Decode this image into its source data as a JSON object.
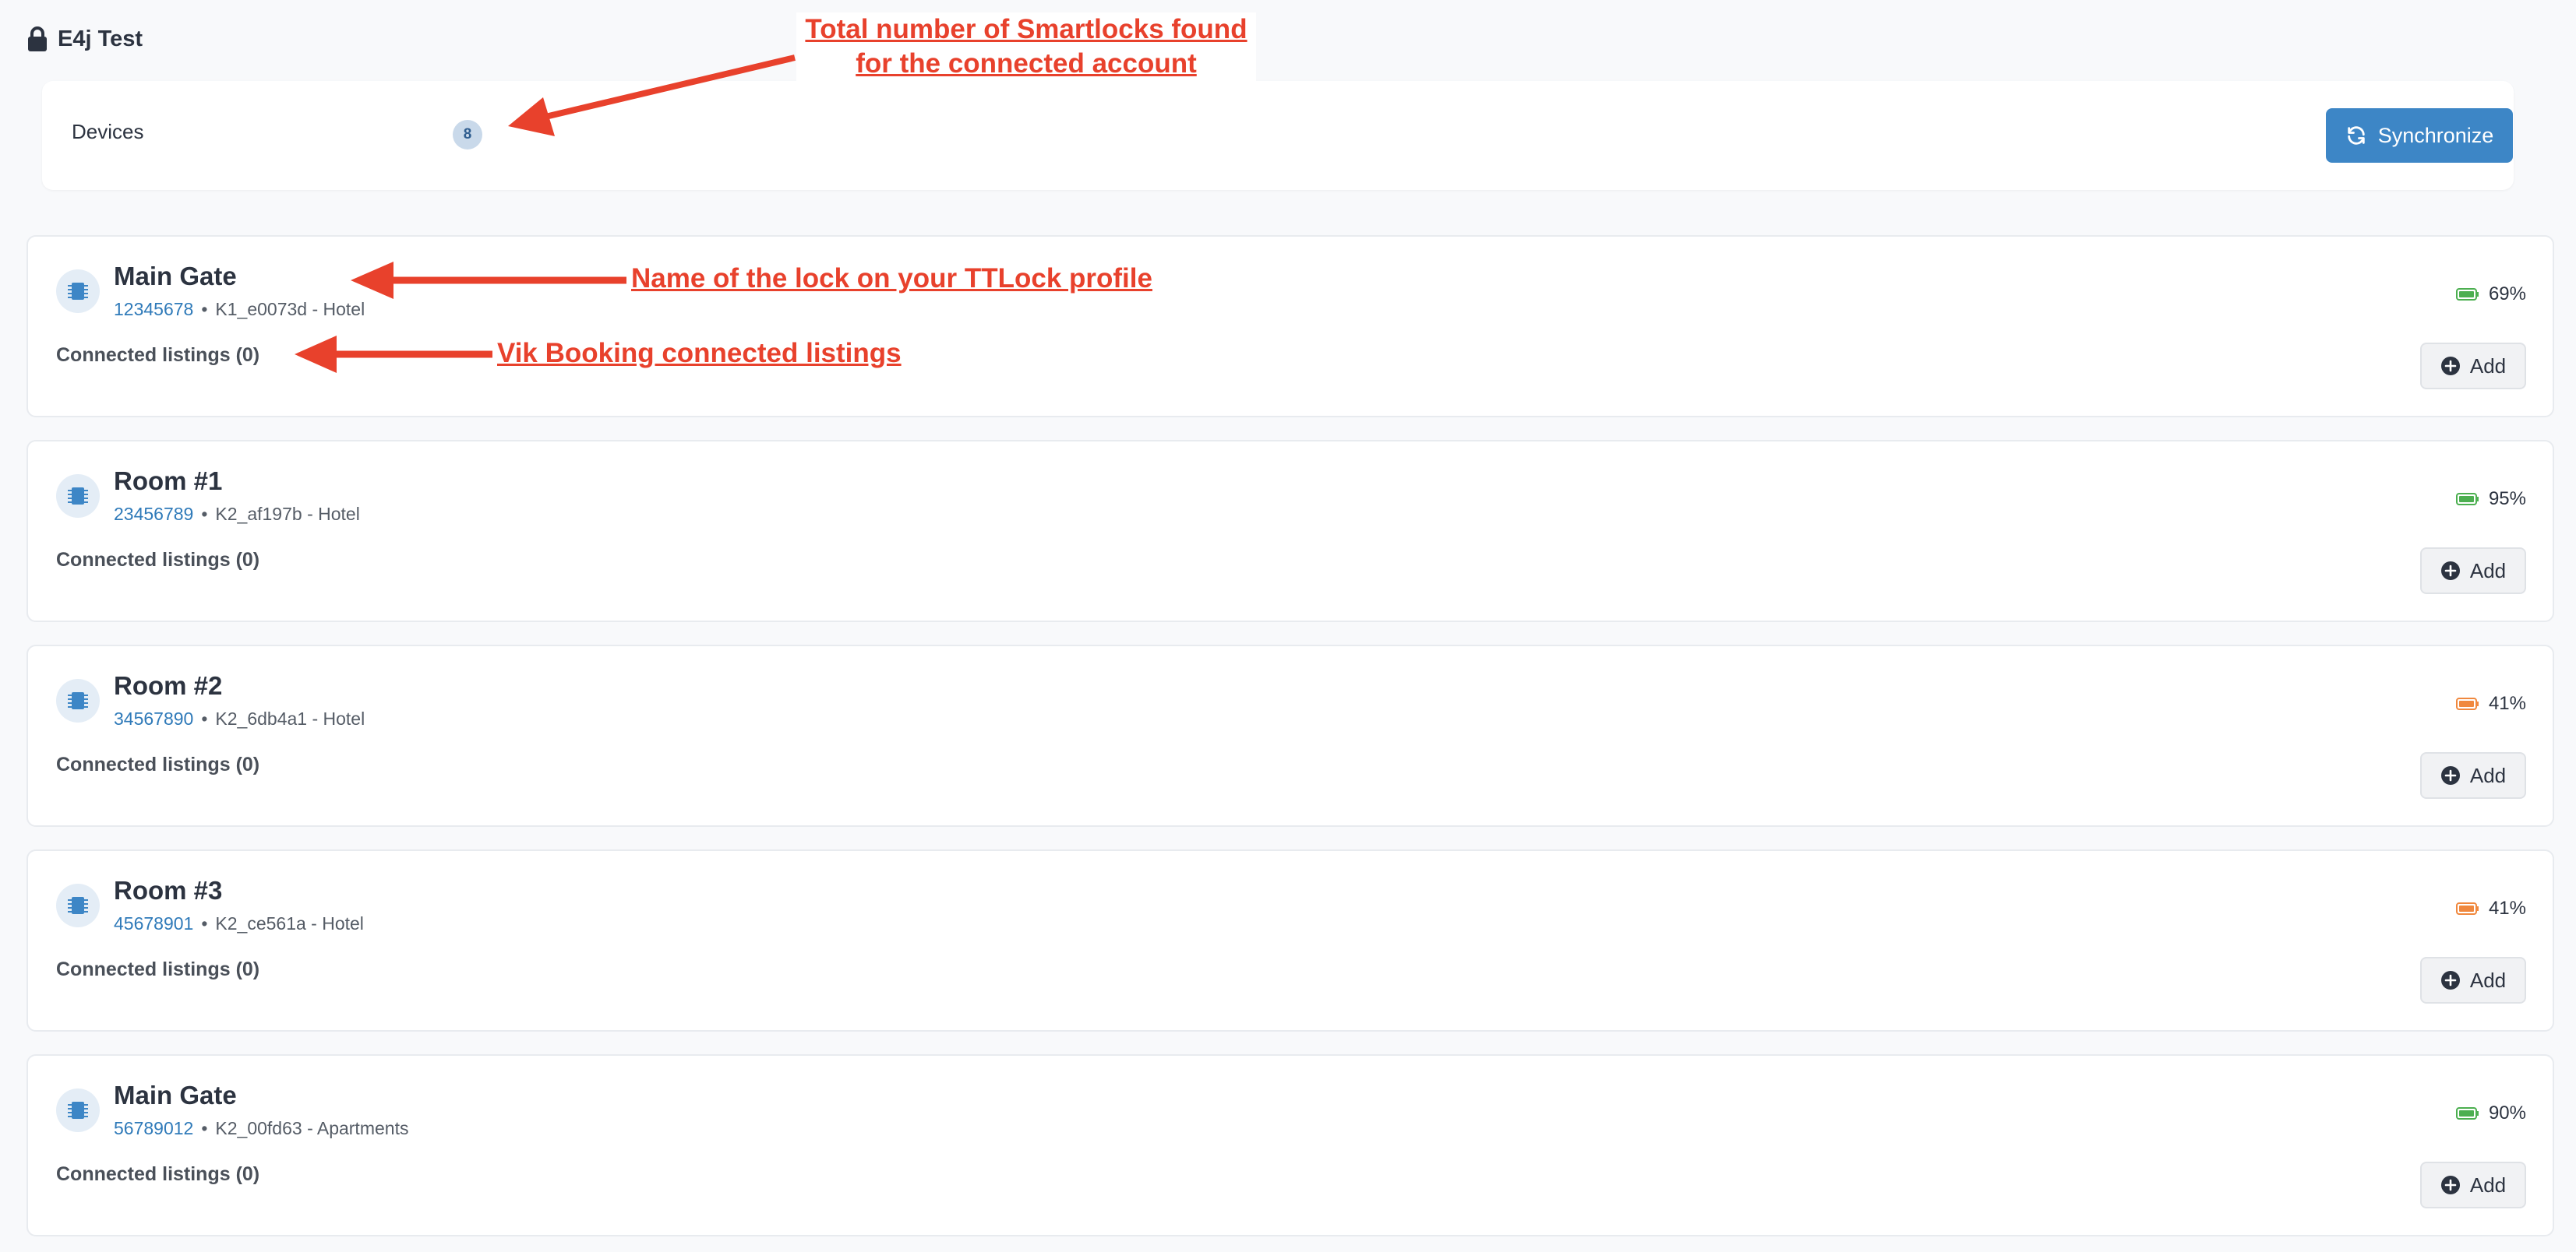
{
  "app": {
    "title": "E4j Test"
  },
  "devices": {
    "label": "Devices",
    "count": "8"
  },
  "sync_button": {
    "label": "Synchronize"
  },
  "colors": {
    "accent": "#3d86c6",
    "battery_good": "#4caf50",
    "battery_mid": "#f0883e",
    "annotation": "#e8412c",
    "id_link": "#2f7ab9"
  },
  "locks": [
    {
      "name": "Main Gate",
      "id": "12345678",
      "separator": "•",
      "detail": "K1_e0073d - Hotel",
      "connected_label": "Connected listings (0)",
      "battery": "69%",
      "battery_level": "good",
      "add_label": "Add"
    },
    {
      "name": "Room #1",
      "id": "23456789",
      "separator": "•",
      "detail": "K2_af197b - Hotel",
      "connected_label": "Connected listings (0)",
      "battery": "95%",
      "battery_level": "good",
      "add_label": "Add"
    },
    {
      "name": "Room #2",
      "id": "34567890",
      "separator": "•",
      "detail": "K2_6db4a1 - Hotel",
      "connected_label": "Connected listings (0)",
      "battery": "41%",
      "battery_level": "mid",
      "add_label": "Add"
    },
    {
      "name": "Room #3",
      "id": "45678901",
      "separator": "•",
      "detail": "K2_ce561a - Hotel",
      "connected_label": "Connected listings (0)",
      "battery": "41%",
      "battery_level": "mid",
      "add_label": "Add"
    },
    {
      "name": "Main Gate",
      "id": "56789012",
      "separator": "•",
      "detail": "K2_00fd63 - Apartments",
      "connected_label": "Connected listings (0)",
      "battery": "90%",
      "battery_level": "good",
      "add_label": "Add"
    }
  ],
  "annotations": {
    "total_line1": "Total number of Smartlocks found",
    "total_line2": "for the connected account",
    "lock_name": "Name of the lock  on your TTLock profile",
    "vik_booking": "Vik Booking connected listings"
  }
}
